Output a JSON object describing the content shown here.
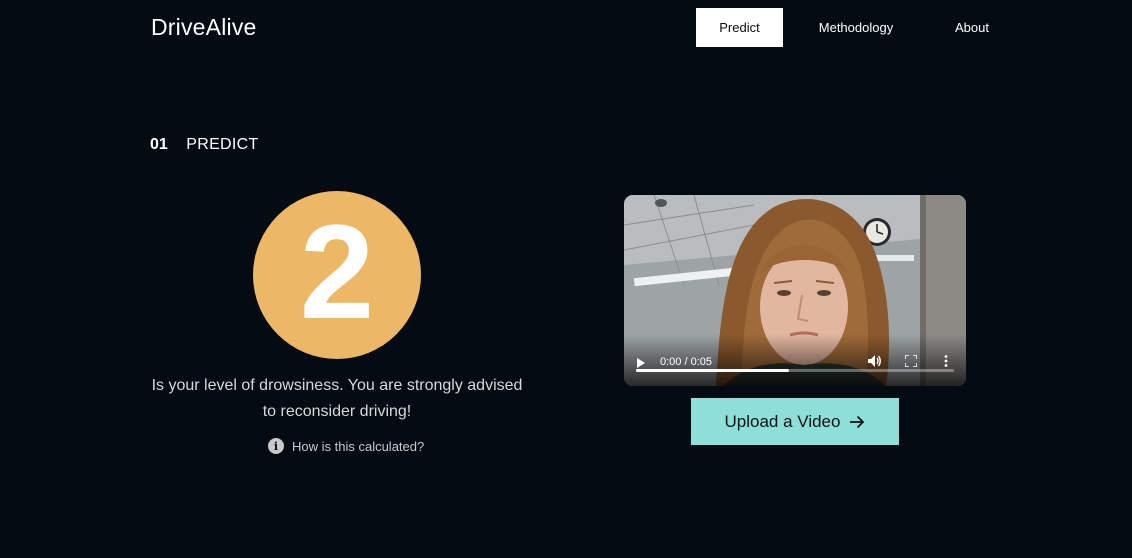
{
  "header": {
    "logo": "DriveAlive",
    "nav": [
      {
        "label": "Predict",
        "active": true
      },
      {
        "label": "Methodology",
        "active": false
      },
      {
        "label": "About",
        "active": false
      }
    ]
  },
  "section": {
    "number": "01",
    "title": "PREDICT"
  },
  "result": {
    "score": "2",
    "message": "Is your level of drowsiness. You are strongly advised to reconsider driving!",
    "calc_link": "How is this calculated?",
    "score_color": "#edb866"
  },
  "video": {
    "time": "0:00 / 0:05",
    "progress": 0.48,
    "icons": [
      "play-icon",
      "volume-icon",
      "fullscreen-icon",
      "more-vert-icon"
    ]
  },
  "upload": {
    "label": "Upload a Video",
    "color": "#8edfd8"
  },
  "colors": {
    "background": "#040b13",
    "accent": "#8edfd8",
    "score": "#edb866"
  }
}
